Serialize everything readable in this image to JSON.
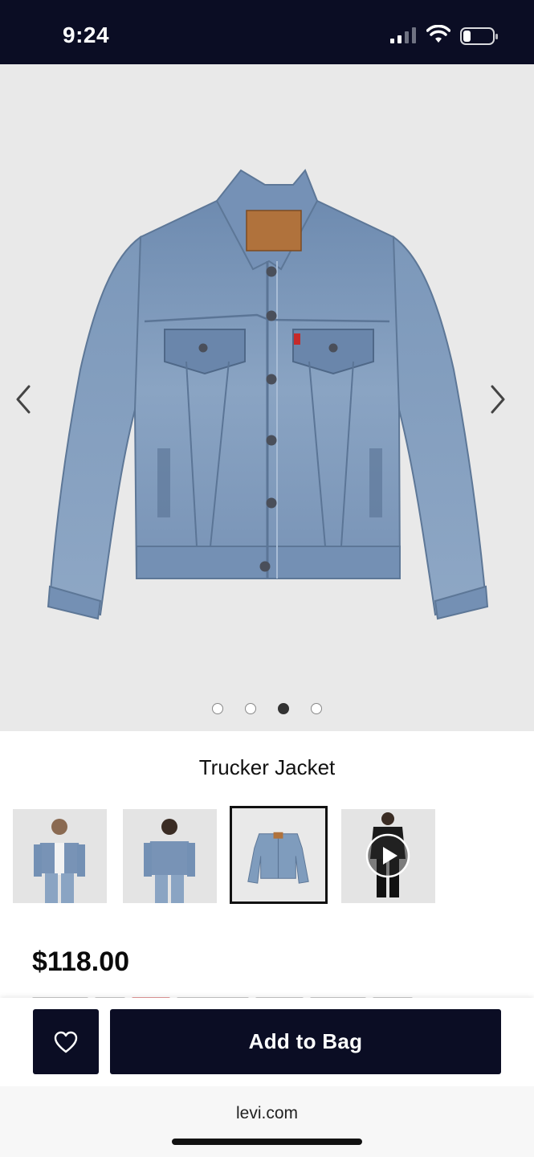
{
  "status_bar": {
    "time": "9:24"
  },
  "hero": {
    "image": "denim-trucker-jacket",
    "dots_total": 4,
    "dots_active": 3,
    "prev": "chevron-left-icon",
    "next": "chevron-right-icon"
  },
  "product": {
    "title": "Trucker Jacket",
    "price": "$118.00"
  },
  "thumbnails": [
    {
      "image": "model-front",
      "selected": false
    },
    {
      "image": "model-back",
      "selected": false
    },
    {
      "image": "jacket-flat",
      "selected": true
    },
    {
      "image": "model-video",
      "selected": false,
      "icon": "play-icon"
    }
  ],
  "actions": {
    "wishlist_icon": "heart-icon",
    "add_to_bag": "Add to Bag"
  },
  "browser": {
    "url": "levi.com"
  },
  "colors": {
    "navy": "#0b0d24",
    "hero_bg": "#e9e9e9",
    "denim": "#7f9cbd"
  }
}
